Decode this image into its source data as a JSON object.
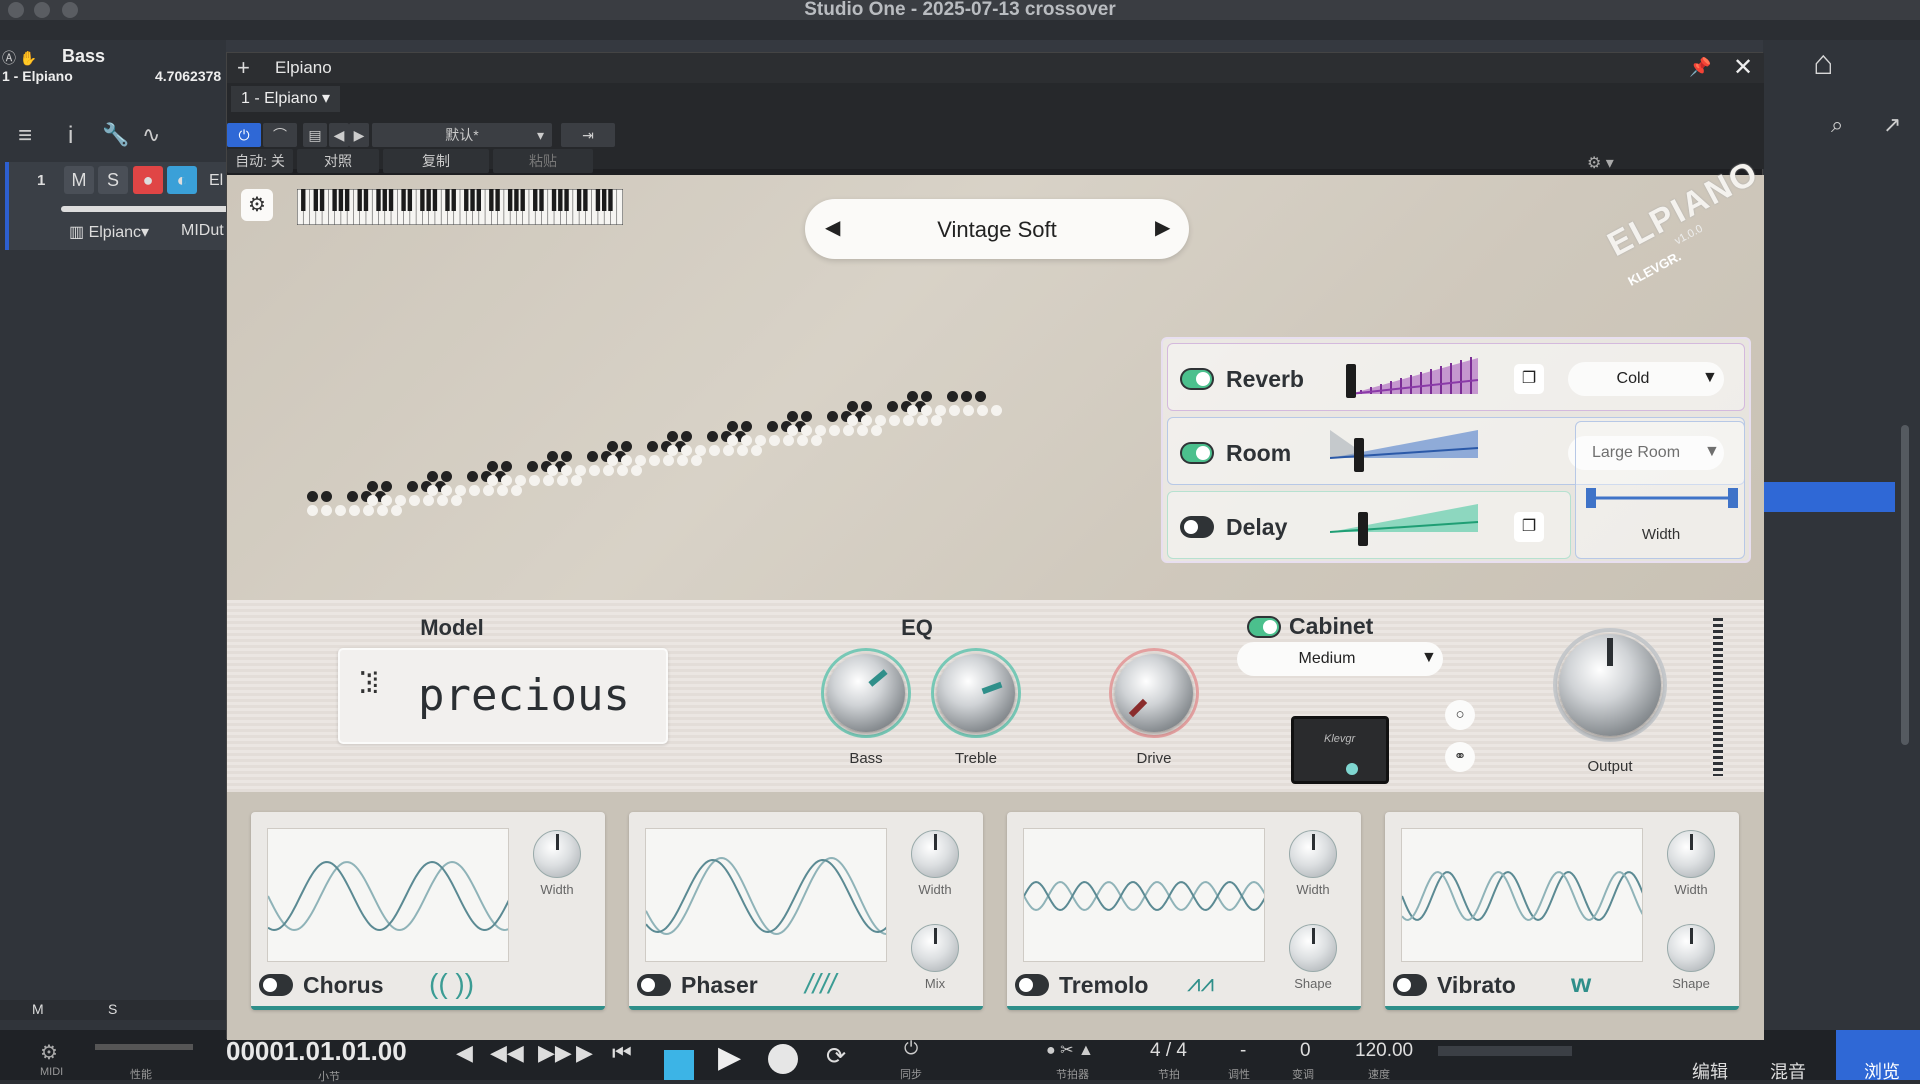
{
  "window": {
    "title": "Studio One - 2025-07-13 crossover"
  },
  "daw": {
    "track_header": {
      "name": "Bass",
      "sub": "1 - Elpiano",
      "value": "4.7062378"
    },
    "track": {
      "number": "1",
      "mute": "M",
      "solo": "S",
      "name_trunc": "El",
      "instrument": "Elpianc",
      "midi": "MIDut"
    },
    "bottom_mute": "M",
    "bottom_solo": "S",
    "transport": {
      "time": "00001.01.01.00",
      "signature": "4 / 4",
      "key": "-",
      "transpose": "0",
      "tempo": "120.00",
      "label_midi": "MIDI",
      "label_perf": "性能",
      "label_bar": "小节",
      "label_sync": "同步",
      "label_metronome": "节拍器",
      "label_beat": "节拍",
      "label_key": "调性",
      "label_transpose": "变调",
      "label_speed": "速度"
    },
    "right_tabs": {
      "edit": "编辑",
      "mix": "混音",
      "browse": "浏览"
    }
  },
  "plugin": {
    "title": "Elpiano",
    "instance": "1 - Elpiano",
    "preset_field": "默认*",
    "auto": "自动: 关",
    "compare": "对照",
    "copy": "复制",
    "paste": "粘贴"
  },
  "elpiano": {
    "preset_name": "Vintage Soft",
    "logo": "ELPIANO",
    "version": "v1.0.0",
    "brand": "KLEVGR.",
    "space": {
      "reverb": {
        "label": "Reverb",
        "type": "Cold",
        "on": true
      },
      "room": {
        "label": "Room",
        "type": "Large Room",
        "on": true
      },
      "delay": {
        "label": "Delay",
        "on": false
      },
      "width_label": "Width"
    },
    "model": {
      "heading": "Model",
      "value": "precious"
    },
    "eq": {
      "heading": "EQ",
      "bass": "Bass",
      "treble": "Treble"
    },
    "drive": "Drive",
    "cabinet": {
      "label": "Cabinet",
      "size": "Medium",
      "on": true,
      "amp_brand": "Klevgr"
    },
    "output": "Output",
    "fx": [
      {
        "name": "Chorus",
        "knob1": "Width",
        "on": false
      },
      {
        "name": "Phaser",
        "knob1": "Width",
        "knob2": "Mix",
        "on": false
      },
      {
        "name": "Tremolo",
        "knob1": "Width",
        "knob2": "Shape",
        "on": false
      },
      {
        "name": "Vibrato",
        "knob1": "Width",
        "knob2": "Shape",
        "on": false
      }
    ],
    "colors": {
      "reverb": "#a24fb8",
      "room": "#3f73c8",
      "delay": "#3cc59a",
      "accent_teal": "#2f8f8a",
      "toggle_on": "#4bc08d"
    }
  }
}
